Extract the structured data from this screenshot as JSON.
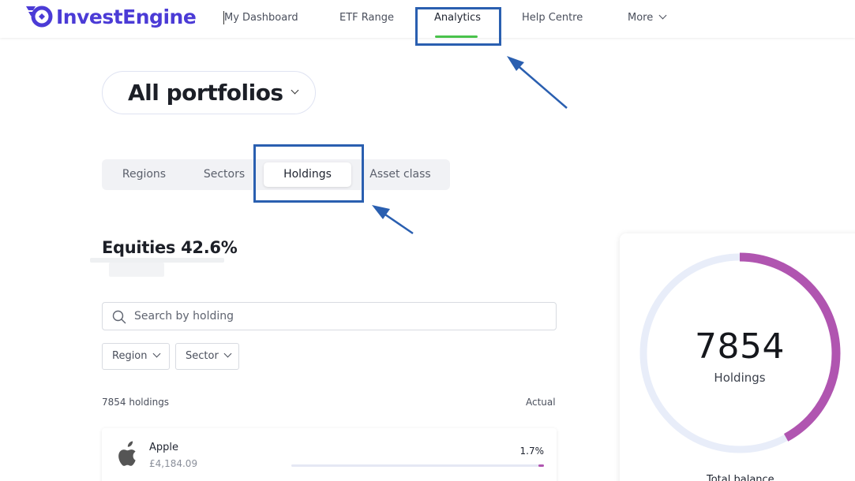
{
  "brand": {
    "name": "InvestEngine",
    "color": "#4b3bd6"
  },
  "nav": {
    "items": [
      {
        "label": "My Dashboard"
      },
      {
        "label": "ETF Range"
      },
      {
        "label": "Analytics",
        "active": true
      },
      {
        "label": "Help Centre"
      },
      {
        "label": "More"
      }
    ],
    "active_color": "#49c24b"
  },
  "portfolio_selector": {
    "label": "All portfolios"
  },
  "tabs": [
    {
      "label": "Regions"
    },
    {
      "label": "Sectors"
    },
    {
      "label": "Holdings",
      "active": true
    },
    {
      "label": "Asset class"
    }
  ],
  "equities": {
    "heading": "Equities 42.6%"
  },
  "search": {
    "placeholder": "Search by holding",
    "value": ""
  },
  "filters": [
    {
      "label": "Region"
    },
    {
      "label": "Sector"
    }
  ],
  "list": {
    "count_label": "7854 holdings",
    "column_label": "Actual",
    "holdings": [
      {
        "name": "Apple",
        "value": "£4,184.09",
        "percent": "1.7%",
        "share": 0.017,
        "icon": "apple-icon"
      }
    ]
  },
  "summary": {
    "holdings_count": "7854",
    "holdings_label": "Holdings",
    "total_balance_label": "Total balance",
    "ring_fill_fraction": 0.42,
    "ring_color": "#b055b0",
    "ring_track_color": "#e8edf9"
  },
  "annotation_color": "#2a5fb0"
}
